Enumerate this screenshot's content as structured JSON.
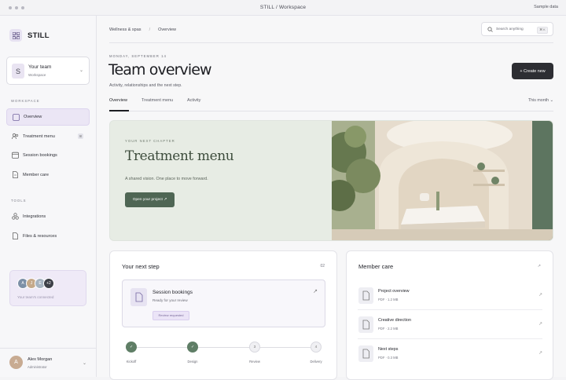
{
  "window": {
    "title": "STILL / Workspace",
    "right_label": "Sample data"
  },
  "sidebar": {
    "logo_text": "STILL",
    "team": {
      "initial": "S",
      "name": "Your team",
      "sub": "Workspace"
    },
    "workspace_label": "WORKSPACE",
    "tools_label": "TOOLS",
    "workspace_items": [
      {
        "label": "Overview",
        "icon": "overview-icon",
        "active": true
      },
      {
        "label": "Treatment menu",
        "icon": "people-icon",
        "badge": "8"
      },
      {
        "label": "Session bookings",
        "icon": "calendar-icon"
      },
      {
        "label": "Member care",
        "icon": "document-icon"
      }
    ],
    "tools_items": [
      {
        "label": "Integrations",
        "icon": "integrations-icon"
      },
      {
        "label": "Files & resources",
        "icon": "files-icon"
      }
    ],
    "connected": {
      "avatars": [
        "A",
        "J",
        "E",
        "+2"
      ],
      "text": "Your team's connected",
      "colors": [
        "#7c8fa6",
        "#c5a98a",
        "#a6b3c0",
        "#3d4048"
      ]
    },
    "user": {
      "initial": "A",
      "name": "Alex Morgan",
      "role": "Administrator"
    }
  },
  "header": {
    "breadcrumb": [
      "Wellness & spas",
      "Overview"
    ],
    "search_placeholder": "Search anything",
    "search_shortcut": "⌘ K"
  },
  "page": {
    "date": "MONDAY, SEPTEMBER 14",
    "title": "Team overview",
    "subtitle": "Activity, relationships and the next step.",
    "create_button": "+ Create new",
    "tabs": [
      "Overview",
      "Treatment menu",
      "Activity"
    ],
    "period": "This month ⌄"
  },
  "hero": {
    "kicker": "YOUR NEXT CHAPTER",
    "title": "Treatment menu",
    "text": "A shared vision. One place to move forward.",
    "button": "Open your project ↗"
  },
  "next_step": {
    "title": "Your next step",
    "count": "02",
    "item_title": "Session bookings",
    "item_sub": "Ready for your review",
    "tag": "Review requested",
    "steps": [
      {
        "label": "Kickoff",
        "mark": "✓",
        "done": true
      },
      {
        "label": "Design",
        "mark": "✓",
        "done": true
      },
      {
        "label": "Review",
        "mark": "3",
        "done": false
      },
      {
        "label": "Delivery",
        "mark": "4",
        "done": false
      }
    ]
  },
  "member_care": {
    "title": "Member care",
    "files": [
      {
        "title": "Project overview",
        "meta": "PDF · 1.2 MB"
      },
      {
        "title": "Creative direction",
        "meta": "PDF · 2.2 MB"
      },
      {
        "title": "Next steps",
        "meta": "PDF · 0.3 MB"
      }
    ]
  }
}
